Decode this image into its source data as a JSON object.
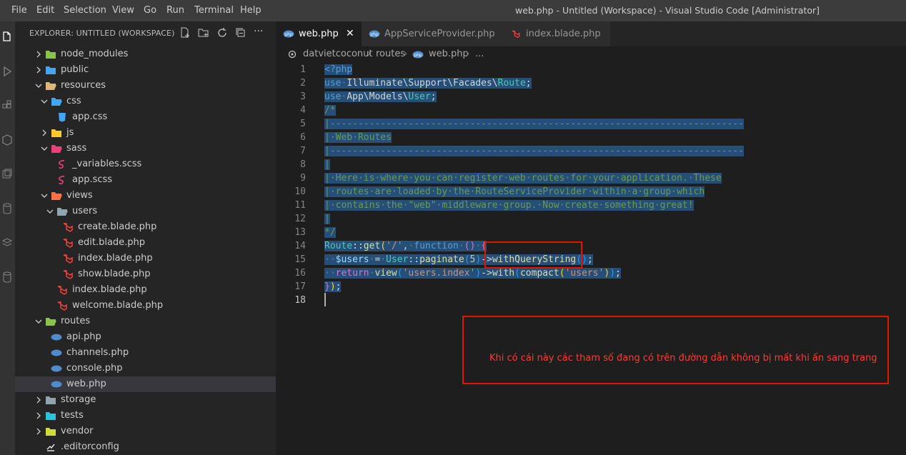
{
  "menu": [
    "File",
    "Edit",
    "Selection",
    "View",
    "Go",
    "Run",
    "Terminal",
    "Help"
  ],
  "window_title": "web.php - Untitled (Workspace) - Visual Studio Code [Administrator]",
  "sidebar": {
    "title": "EXPLORER: UNTITLED (WORKSPACE)",
    "actions": [
      "new-file",
      "new-folder",
      "refresh",
      "collapse-all",
      "more"
    ],
    "more_label": "···",
    "items": [
      {
        "label": "node_modules",
        "depth": 1,
        "type": "folder",
        "state": "collapsed",
        "icon_color": "#8bc34a"
      },
      {
        "label": "public",
        "depth": 1,
        "type": "folder",
        "state": "collapsed",
        "icon_color": "#42a5f5"
      },
      {
        "label": "resources",
        "depth": 1,
        "type": "folder",
        "state": "expanded",
        "icon_color": "#dcb67a"
      },
      {
        "label": "css",
        "depth": 2,
        "type": "folder",
        "state": "expanded",
        "icon_color": "#42a5f5"
      },
      {
        "label": "app.css",
        "depth": 3,
        "type": "file",
        "icon": "css",
        "icon_color": "#42a5f5"
      },
      {
        "label": "js",
        "depth": 2,
        "type": "folder",
        "state": "collapsed",
        "icon_color": "#ffca28"
      },
      {
        "label": "sass",
        "depth": 2,
        "type": "folder",
        "state": "expanded",
        "icon_color": "#ec407a"
      },
      {
        "label": "_variables.scss",
        "depth": 3,
        "type": "file",
        "icon": "sass",
        "icon_color": "#ec407a"
      },
      {
        "label": "app.scss",
        "depth": 3,
        "type": "file",
        "icon": "sass",
        "icon_color": "#ec407a"
      },
      {
        "label": "views",
        "depth": 2,
        "type": "folder",
        "state": "expanded",
        "icon_color": "#ff7043"
      },
      {
        "label": "users",
        "depth": 3,
        "type": "folder",
        "state": "expanded",
        "icon_color": "#90a4ae"
      },
      {
        "label": "create.blade.php",
        "depth": 4,
        "type": "file",
        "icon": "laravel",
        "icon_color": "#f4433a"
      },
      {
        "label": "edit.blade.php",
        "depth": 4,
        "type": "file",
        "icon": "laravel",
        "icon_color": "#f4433a"
      },
      {
        "label": "index.blade.php",
        "depth": 4,
        "type": "file",
        "icon": "laravel",
        "icon_color": "#f4433a"
      },
      {
        "label": "show.blade.php",
        "depth": 4,
        "type": "file",
        "icon": "laravel",
        "icon_color": "#f4433a"
      },
      {
        "label": "index.blade.php",
        "depth": 3,
        "type": "file",
        "icon": "laravel",
        "icon_color": "#f4433a"
      },
      {
        "label": "welcome.blade.php",
        "depth": 3,
        "type": "file",
        "icon": "laravel",
        "icon_color": "#f4433a"
      },
      {
        "label": "routes",
        "depth": 1,
        "type": "folder",
        "state": "expanded",
        "icon_color": "#8bc34a"
      },
      {
        "label": "api.php",
        "depth": 2,
        "type": "file",
        "icon": "php",
        "icon_color": "#4f8cc9"
      },
      {
        "label": "channels.php",
        "depth": 2,
        "type": "file",
        "icon": "php",
        "icon_color": "#4f8cc9"
      },
      {
        "label": "console.php",
        "depth": 2,
        "type": "file",
        "icon": "php",
        "icon_color": "#4f8cc9"
      },
      {
        "label": "web.php",
        "depth": 2,
        "type": "file",
        "icon": "php",
        "icon_color": "#4f8cc9",
        "selected": true
      },
      {
        "label": "storage",
        "depth": 1,
        "type": "folder",
        "state": "collapsed",
        "icon_color": "#90a4ae"
      },
      {
        "label": "tests",
        "depth": 1,
        "type": "folder",
        "state": "collapsed",
        "icon_color": "#26c6da"
      },
      {
        "label": "vendor",
        "depth": 1,
        "type": "folder",
        "state": "collapsed",
        "icon_color": "#cddc39"
      },
      {
        "label": ".editorconfig",
        "depth": 1,
        "type": "file",
        "icon": "editorconfig",
        "icon_color": "#e0e0e0"
      }
    ]
  },
  "tabs": [
    {
      "label": "web.php",
      "icon": "php",
      "active": true,
      "close": "✕"
    },
    {
      "label": "AppServiceProvider.php",
      "icon": "php",
      "active": false
    },
    {
      "label": "index.blade.php",
      "icon": "laravel",
      "active": false
    }
  ],
  "breadcrumb": [
    "datvietcoconut",
    "routes",
    "web.php",
    "..."
  ],
  "editor": {
    "active_line": 18,
    "line_numbers": [
      "1",
      "2",
      "3",
      "4",
      "5",
      "6",
      "7",
      "8",
      "9",
      "10",
      "11",
      "12",
      "13",
      "14",
      "15",
      "16",
      "17",
      "18"
    ],
    "lines": [
      [
        {
          "t": "<?php",
          "c": "kw"
        }
      ],
      [
        {
          "t": "use",
          "c": "kw"
        },
        {
          "t": "·",
          "c": "ws"
        },
        {
          "t": "Illuminate\\Support\\Facades\\",
          "c": "pl"
        },
        {
          "t": "Route",
          "c": "cl"
        },
        {
          "t": ";",
          "c": "pl"
        }
      ],
      [
        {
          "t": "use",
          "c": "kw"
        },
        {
          "t": "·",
          "c": "ws"
        },
        {
          "t": "App\\Models\\",
          "c": "pl"
        },
        {
          "t": "User",
          "c": "cl"
        },
        {
          "t": ";",
          "c": "pl"
        }
      ],
      [
        {
          "t": "/*",
          "c": "cm"
        }
      ],
      [
        {
          "t": "|--------------------------------------------------------------------------",
          "c": "cm"
        }
      ],
      [
        {
          "t": "|·Web·Routes",
          "c": "cm"
        }
      ],
      [
        {
          "t": "|--------------------------------------------------------------------------",
          "c": "cm"
        }
      ],
      [
        {
          "t": "|",
          "c": "cm"
        }
      ],
      [
        {
          "t": "|·Here·is·where·you·can·register·web·routes·for·your·application.·These",
          "c": "cm"
        }
      ],
      [
        {
          "t": "|·routes·are·loaded·by·the·RouteServiceProvider·within·a·group·which",
          "c": "cm"
        }
      ],
      [
        {
          "t": "|·contains·the·\"web\"·middleware·group.·Now·create·something·great!",
          "c": "cm"
        }
      ],
      [
        {
          "t": "|",
          "c": "cm"
        }
      ],
      [
        {
          "t": "*/",
          "c": "cm"
        }
      ],
      [
        {
          "t": "Route",
          "c": "cl"
        },
        {
          "t": "::",
          "c": "pl"
        },
        {
          "t": "get",
          "c": "fn"
        },
        {
          "t": "(",
          "c": "by"
        },
        {
          "t": "'/'",
          "c": "st"
        },
        {
          "t": ",",
          "c": "pl"
        },
        {
          "t": "·",
          "c": "ws"
        },
        {
          "t": "function",
          "c": "kw"
        },
        {
          "t": "·",
          "c": "ws"
        },
        {
          "t": "()",
          "c": "br"
        },
        {
          "t": "·",
          "c": "ws"
        },
        {
          "t": "{",
          "c": "br"
        }
      ],
      [
        {
          "t": "··",
          "c": "ws"
        },
        {
          "t": "$users",
          "c": "vr"
        },
        {
          "t": "·",
          "c": "ws"
        },
        {
          "t": "=",
          "c": "pl"
        },
        {
          "t": "·",
          "c": "ws"
        },
        {
          "t": "User",
          "c": "cl"
        },
        {
          "t": "::",
          "c": "pl"
        },
        {
          "t": "paginate",
          "c": "fn"
        },
        {
          "t": "(",
          "c": "bb"
        },
        {
          "t": "5",
          "c": "nm"
        },
        {
          "t": ")",
          "c": "bb"
        },
        {
          "t": "->",
          "c": "pl"
        },
        {
          "t": "withQueryString",
          "c": "fn"
        },
        {
          "t": "()",
          "c": "bb"
        },
        {
          "t": ";",
          "c": "pl"
        }
      ],
      [
        {
          "t": "··",
          "c": "ws"
        },
        {
          "t": "return",
          "c": "br"
        },
        {
          "t": "·",
          "c": "ws"
        },
        {
          "t": "view",
          "c": "fn"
        },
        {
          "t": "(",
          "c": "bb"
        },
        {
          "t": "'users.index'",
          "c": "st"
        },
        {
          "t": ")",
          "c": "bb"
        },
        {
          "t": "->",
          "c": "pl"
        },
        {
          "t": "with",
          "c": "fn"
        },
        {
          "t": "(",
          "c": "bb"
        },
        {
          "t": "compact",
          "c": "fn"
        },
        {
          "t": "(",
          "c": "by"
        },
        {
          "t": "'users'",
          "c": "st"
        },
        {
          "t": ")",
          "c": "by"
        },
        {
          "t": ")",
          "c": "bb"
        },
        {
          "t": ";",
          "c": "pl"
        }
      ],
      [
        {
          "t": "}",
          "c": "br"
        },
        {
          "t": ")",
          "c": "by"
        },
        {
          "t": ";",
          "c": "pl"
        }
      ],
      []
    ]
  },
  "annotation": {
    "note": "Khi có cái này các tham số đang có trên đường dẫn không bị mất khi ấn sang trang",
    "color": "#e51400"
  },
  "colors": {
    "titlebar": "#3c3c3c",
    "activitybar": "#333333",
    "sidebar": "#252526",
    "editor": "#1e1e1e",
    "selection": "#264f78"
  }
}
